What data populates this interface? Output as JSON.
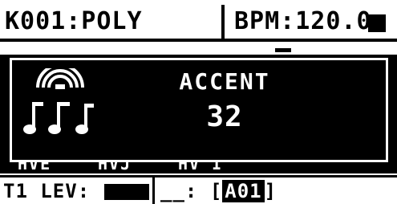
{
  "header": {
    "kit_name": "K001:POLY",
    "bpm": "BPM:120.0"
  },
  "popup": {
    "parameter_name": "ACCENT",
    "parameter_value": "32"
  },
  "page_labels": [
    "HVE",
    "HVJ",
    "HV I"
  ],
  "footer": {
    "track_level_label": "T1 LEV:",
    "track_level_fraction": 1.0,
    "sample_slot_label": "__:",
    "sample_open_bracket": "[",
    "sample_id": "A01",
    "sample_close_bracket": "]"
  },
  "icons": {
    "popup_icon": "accent-notes-icon",
    "transport": "play-status-icon"
  },
  "colors": {
    "background": "#ffffff",
    "foreground": "#000000"
  }
}
